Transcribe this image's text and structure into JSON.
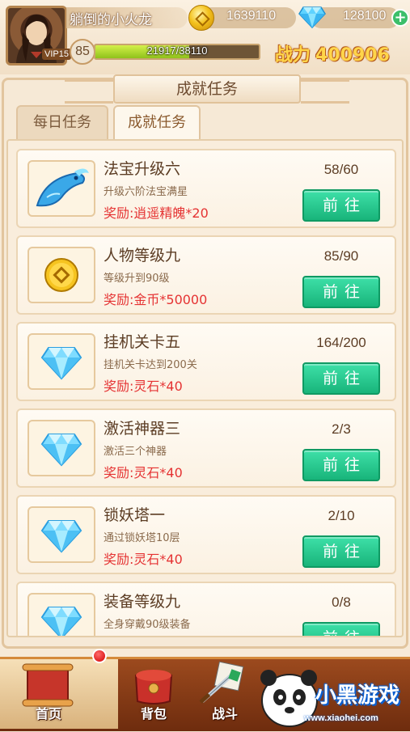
{
  "player": {
    "name": "躺倒的小火龙",
    "vip": "VIP15",
    "level": "85",
    "exp": "21917/38110",
    "exp_fraction": 0.575,
    "power_label": "战力",
    "power_value": "400906"
  },
  "resources": {
    "gold": "1639110",
    "gems": "128100",
    "gold_icon": "gold-coin-icon",
    "gem_icon": "diamond-icon",
    "add_icon": "plus-icon"
  },
  "panel": {
    "title": "成就任务",
    "tabs": [
      {
        "label": "日任务",
        "prefix": "每",
        "full": "每日任务"
      },
      {
        "label": "成就任务"
      }
    ]
  },
  "tasks": [
    {
      "title": "法宝升级六",
      "desc": "升级六阶法宝满星",
      "reward": "奖励:逍遥精魄*20",
      "progress": "58/60",
      "button": "前往",
      "icon": "fish-treasure-icon"
    },
    {
      "title": "人物等级九",
      "desc": "等级升到90级",
      "reward": "奖励:金币*50000",
      "progress": "85/90",
      "button": "前往",
      "icon": "gold-coin-icon"
    },
    {
      "title": "挂机关卡五",
      "desc": "挂机关卡达到200关",
      "reward": "奖励:灵石*40",
      "progress": "164/200",
      "button": "前往",
      "icon": "diamond-icon"
    },
    {
      "title": "激活神器三",
      "desc": "激活三个神器",
      "reward": "奖励:灵石*40",
      "progress": "2/3",
      "button": "前往",
      "icon": "diamond-icon"
    },
    {
      "title": "锁妖塔一",
      "desc": "通过锁妖塔10层",
      "reward": "奖励:灵石*40",
      "progress": "2/10",
      "button": "前往",
      "icon": "diamond-icon"
    },
    {
      "title": "装备等级九",
      "desc": "全身穿戴90级装备",
      "reward": "",
      "progress": "0/8",
      "button": "前往",
      "icon": "diamond-icon"
    }
  ],
  "nav": {
    "home": "首页",
    "bag": "背包",
    "battle": "战斗"
  },
  "watermark": {
    "brand": "小黑游戏",
    "url": "www.xiaohei.com"
  },
  "colors": {
    "reward_red": "#e53333",
    "button_green": "#18b47a",
    "power_gold": "#ffd54a"
  }
}
